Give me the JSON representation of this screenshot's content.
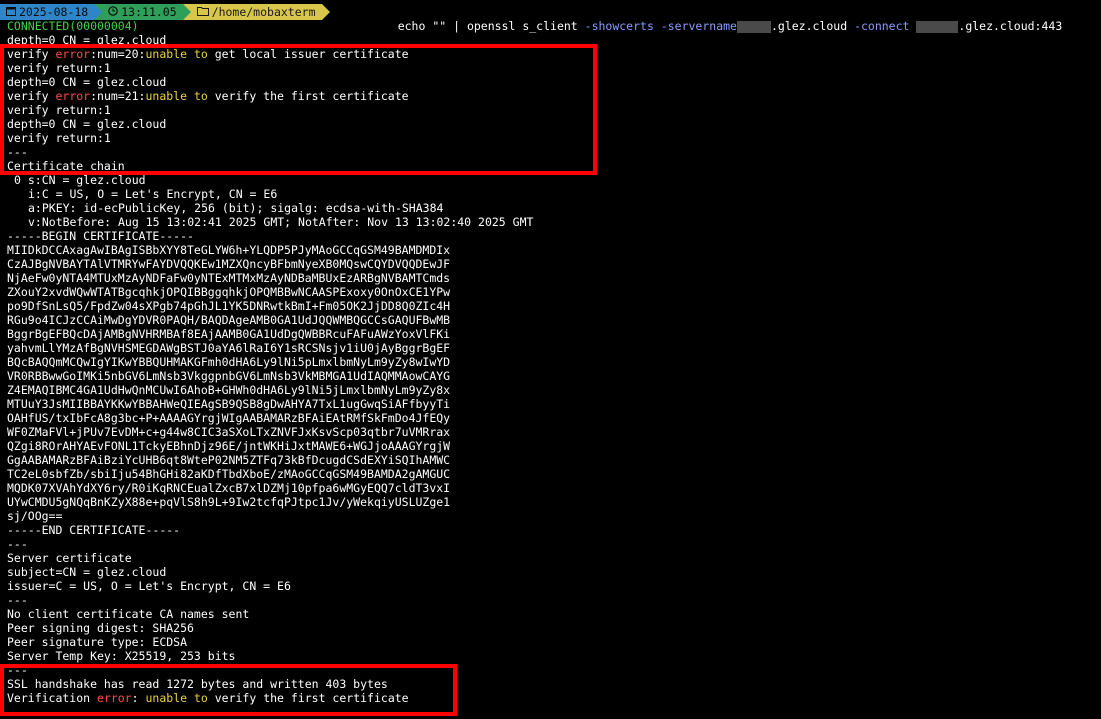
{
  "prompt": {
    "date": "2025-08-18",
    "time": "13:11.05",
    "path": "/home/mobaxterm",
    "date_icon": "calendar-icon",
    "time_icon": "clock-icon",
    "path_icon": "folder-icon"
  },
  "command": {
    "part1": "echo \"\" | openssl s_client ",
    "flag1": "-showcerts -servername",
    "part2": ".glez.cloud ",
    "flag2": "-connect",
    "part3": ".glez.cloud:443"
  },
  "colors": {
    "highlight_border": "#ff0000",
    "error_word": "#ff4a4a",
    "warning_text": "#e9d23a",
    "connected": "#3fd24a"
  },
  "output": {
    "connected": "CONNECTED(00000004)",
    "l_depth0": "depth=0 CN = glez.cloud",
    "l_verify_err20_a": "verify ",
    "l_error": "error",
    "l_err20_b": ":num=20:",
    "l_err20_c": "unable to",
    "l_err20_d": " get local issuer certificate",
    "l_verify_return1": "verify return:1",
    "l_err21_b": ":num=21:",
    "l_err21_d": " verify the first certificate",
    "l_sep": "---",
    "l_chain_title": "Certificate chain",
    "l_chain_s": "0 s:CN = glez.cloud",
    "l_chain_i": "i:C = US, O = Let's Encrypt, CN = E6",
    "l_chain_a": "a:PKEY: id-ecPublicKey, 256 (bit); sigalg: ecdsa-with-SHA384",
    "l_chain_v": "v:NotBefore: Aug 15 13:02:41 2025 GMT; NotAfter: Nov 13 13:02:40 2025 GMT",
    "l_begin": "-----BEGIN CERTIFICATE-----",
    "cert_lines": [
      "MIIDkDCCAxagAwIBAgISBbXYY8TeGLYW6h+YLQDP5PJyMAoGCCqGSM49BAMDMDIx",
      "CzAJBgNVBAYTAlVTMRYwFAYDVQQKEw1MZXQncyBFbmNyeXB0MQswCQYDVQQDEwJF",
      "NjAeFw0yNTA4MTUxMzAyNDFaFw0yNTExMTMxMzAyNDBaMBUxEzARBgNVBAMTCmds",
      "ZXouY2xvdWQwWTATBgcqhkjOPQIBBggqhkjOPQMBBwNCAASPExoxy0OnOxCE1YPw",
      "po9DfSnLsQ5/FpdZw04sXPgb74pGhJL1YK5DNRwtkBmI+Fm05OK2JjDD8Q0ZIc4H",
      "RGu9o4ICJzCCAiMwDgYDVR0PAQH/BAQDAgeAMB0GA1UdJQQWMBQGCCsGAQUFBwMB",
      "BggrBgEFBQcDAjAMBgNVHRMBAf8EAjAAMB0GA1UdDgQWBBRcuFAFuAWzYoxVlFKi",
      "yahvmLlYMzAfBgNVHSMEGDAWgBSTJ0aYA6lRaI6Y1sRCSNsjv1iU0jAyBggrBgEF",
      "BQcBAQQmMCQwIgYIKwYBBQUHMAKGFmh0dHA6Ly9lNi5pLmxlbmNyLm9yZy8wIwYD",
      "VR0RBBwwGoIMKi5nbGV6LmNsb3VkggpnbGV6LmNsb3VkMBMGA1UdIAQMMAowCAYG",
      "Z4EMAQIBMC4GA1UdHwQnMCUwI6AhoB+GHWh0dHA6Ly9lNi5jLmxlbmNyLm9yZy8x",
      "MTUuY3JsMIIBBAYKKwYBBAHWeQIEAgSB9QSB8gDwAHYA7TxL1ugGwqSiAFfbyyTi",
      "OAHfUS/txIbFcA8g3bc+P+AAAAGYrgjWIgAABAMARzBFAiEAtRMfSkFmDo4JfEQy",
      "WF0ZMaFVl+jPUv7EvDM+c+g44w8CIC3aSXoLTxZNVFJxKsvScp03qtbr7uVMRrax",
      "QZgi8ROrAHYAEvFONL1TckyEBhnDjz96E/jntWKHiJxtMAWE6+WGJjoAAAGYrgjW",
      "GgAABAMARzBFAiBziYcUHB6qt8WteP02NM5ZTFq73kBfDcugdCSdEXYiSQIhAMWC",
      "TC2eL0sbfZb/sbiIju54BhGHi82aKDfTbdXboE/zMAoGCCqGSM49BAMDA2gAMGUC",
      "MQDK07XVAhYdXY6ry/R0iKqRNCEualZxcB7xlDZMj10pfpa6wMGyEQQ7cldT3vxI",
      "UYwCMDU5gNQqBnKZyX88e+pqVlS8h9L+9Iw2tcfqPJtpc1Jv/yWekqiyUSLUZge1",
      "sj/OOg=="
    ],
    "l_end": "-----END CERTIFICATE-----",
    "l_server_cert": "Server certificate",
    "l_subject": "subject=CN = glez.cloud",
    "l_issuer": "issuer=C = US, O = Let's Encrypt, CN = E6",
    "l_no_client": "No client certificate CA names sent",
    "l_peer_digest": "Peer signing digest: SHA256",
    "l_peer_sig": "Peer signature type: ECDSA",
    "l_temp_key": "Server Temp Key: X25519, 253 bits",
    "l_handshake": "SSL handshake has read 1272 bytes and written 403 bytes",
    "l_verif_a": "Verification ",
    "l_verif_error": "error",
    "l_verif_b": ": ",
    "l_verif_c": "unable to",
    "l_verif_d": " verify the first certificate"
  }
}
